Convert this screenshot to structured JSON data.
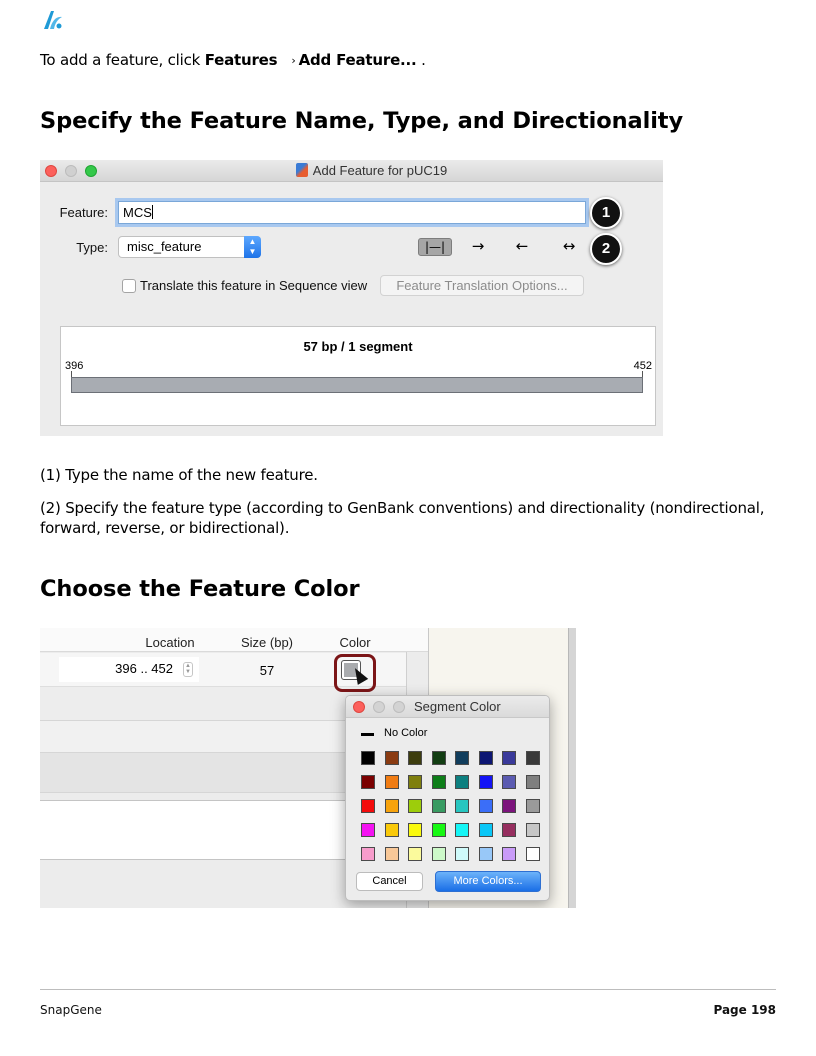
{
  "intro": {
    "prefix": "To add a feature, click ",
    "menu": "Features",
    "separator": "›",
    "command": "Add Feature...",
    "suffix": " ."
  },
  "section1": {
    "heading": "Specify the Feature Name, Type, and Directionality"
  },
  "dialog": {
    "title": "Add Feature for pUC19",
    "feature_label": "Feature:",
    "feature_value": "MCS",
    "type_label": "Type:",
    "type_value": "misc_feature",
    "direction_buttons": {
      "nondirectional": "|—|",
      "forward": "→",
      "reverse": "←",
      "bidirectional": "↔"
    },
    "translate_checkbox": "Translate this feature in Sequence view",
    "translate_checked": false,
    "translation_options_button": "Feature Translation Options...",
    "segment_summary": "57 bp  /  1 segment",
    "segment_start": "396",
    "segment_end": "452",
    "segment_color": "#a8acb2",
    "callouts": [
      "1",
      "2"
    ]
  },
  "notes": {
    "note1": "(1) Type the name of the new feature.",
    "note2": "(2) Specify the feature type (according to GenBank conventions) and directionality (nondirectional, forward, reverse, or bidirectional)."
  },
  "section2": {
    "heading": "Choose the Feature Color"
  },
  "table": {
    "col_location": "Location",
    "col_size": "Size (bp)",
    "col_color": "Color",
    "row_location": "396  ..  452",
    "row_size": "57"
  },
  "segment_color_popup": {
    "title": "Segment Color",
    "no_color_label": "No Color",
    "swatches": [
      [
        "#000000",
        "#8a3b12",
        "#3d3d0e",
        "#123d12",
        "#113d5c",
        "#0d1673",
        "#3a3a9a",
        "#3a3a3a"
      ],
      [
        "#7a0000",
        "#f07c13",
        "#7f7f0e",
        "#0d7d18",
        "#0d7f7f",
        "#1414f5",
        "#5b5bb1",
        "#7f7f7f"
      ],
      [
        "#f30c0c",
        "#f7a30d",
        "#9dcd0b",
        "#389b62",
        "#27c6c0",
        "#3b6ef8",
        "#7c147c",
        "#9a9a9a"
      ],
      [
        "#f413f2",
        "#f9c90a",
        "#fafa0f",
        "#18f814",
        "#15f5f5",
        "#0ac7f7",
        "#962f5f",
        "#c6c6c6"
      ],
      [
        "#f79ccb",
        "#f8c898",
        "#fbfa9c",
        "#cdf9c9",
        "#cffafa",
        "#98c8f8",
        "#c99bf8",
        "#ffffff"
      ]
    ],
    "cancel_label": "Cancel",
    "more_colors_label": "More Colors..."
  },
  "footer": {
    "left": "SnapGene",
    "right": "Page 198"
  }
}
